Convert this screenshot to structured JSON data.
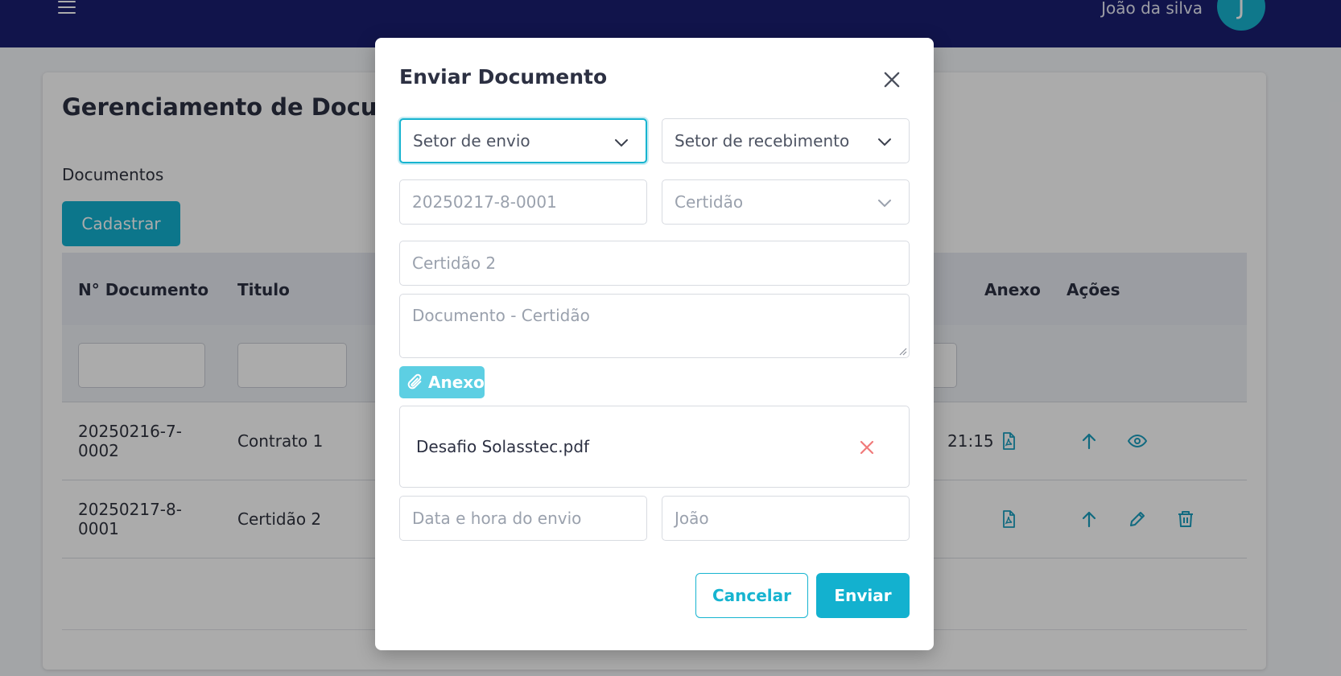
{
  "header": {
    "user_name": "João da silva",
    "avatar_initial": "J"
  },
  "page": {
    "title": "Gerenciamento de Documentos",
    "section_label": "Documentos",
    "add_button": "Cadastrar"
  },
  "table": {
    "columns": {
      "doc_number": "N° Documento",
      "title": "Titulo",
      "attachment": "Anexo",
      "actions": "Ações"
    },
    "rows": [
      {
        "doc_number": "20250216-7-\n0002",
        "title": "Contrato 1",
        "time_partial": "21:15"
      },
      {
        "doc_number": "20250217-8-\n0001",
        "title": "Certidão 2",
        "time_partial": ""
      }
    ]
  },
  "modal": {
    "title": "Enviar Documento",
    "sender_sector_placeholder": "Setor de envio",
    "receiver_sector_placeholder": "Setor de recebimento",
    "doc_number_value": "20250217-8-0001",
    "doc_type_value": "Certidão",
    "doc_title_value": "Certidão 2",
    "description_placeholder": "Documento - Certidão",
    "attach_button": "Anexo",
    "attached_file": "Desafio Solasstec.pdf",
    "send_datetime_placeholder": "Data e hora do envio",
    "sender_value": "João",
    "cancel_button": "Cancelar",
    "send_button": "Enviar"
  },
  "colors": {
    "topbar": "#1a1f71",
    "accent": "#13b1cf",
    "danger": "#f07a7a"
  }
}
